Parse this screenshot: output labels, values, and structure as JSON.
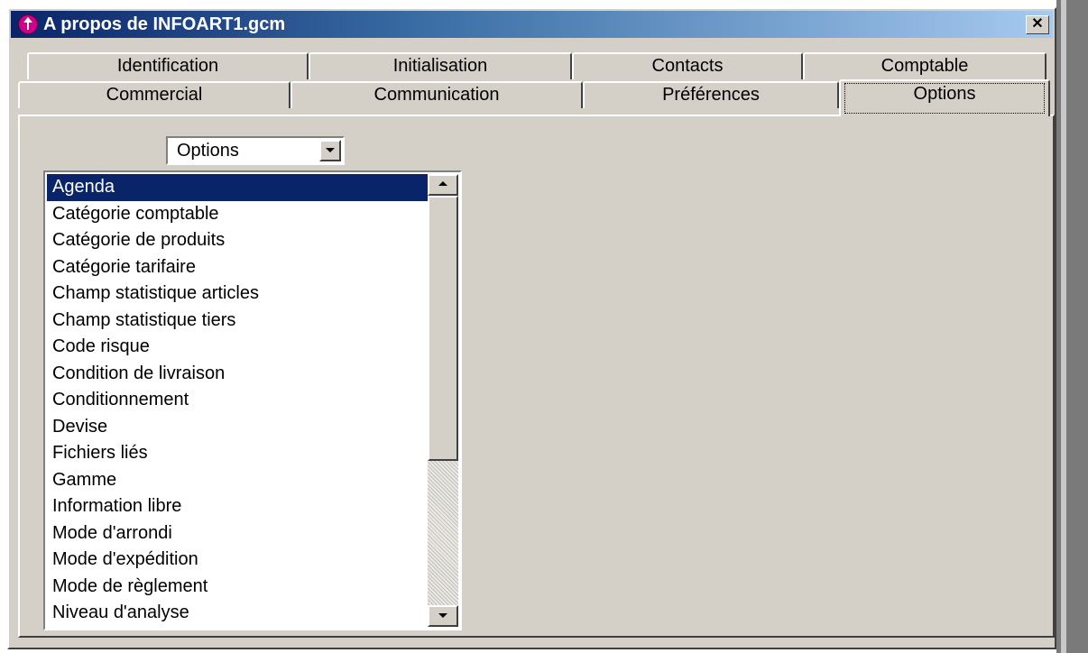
{
  "window": {
    "title": "A propos de INFOART1.gcm",
    "close_glyph": "✕",
    "icon": "app-arrow-icon"
  },
  "colors": {
    "title_bar_start": "#0a246a",
    "title_bar_end": "#a6caf0",
    "selection": "#0a246a",
    "face": "#d4d0c8"
  },
  "tabs_back": [
    {
      "label": "Identification"
    },
    {
      "label": "Initialisation"
    },
    {
      "label": "Contacts"
    },
    {
      "label": "Comptable"
    }
  ],
  "tabs_front": [
    {
      "label": "Commercial"
    },
    {
      "label": "Communication"
    },
    {
      "label": "Préférences"
    },
    {
      "label": "Options",
      "active": true
    }
  ],
  "combo": {
    "value": "Options"
  },
  "list": {
    "selected_index": 0,
    "items": [
      "Agenda",
      "Catégorie comptable",
      "Catégorie de produits",
      "Catégorie tarifaire",
      "Champ statistique articles",
      "Champ statistique tiers",
      "Code risque",
      "Condition de livraison",
      "Conditionnement",
      "Devise",
      "Fichiers liés",
      "Gamme",
      "Information libre",
      "Mode d'arrondi",
      "Mode d'expédition",
      "Mode de règlement",
      "Niveau d'analyse"
    ]
  }
}
